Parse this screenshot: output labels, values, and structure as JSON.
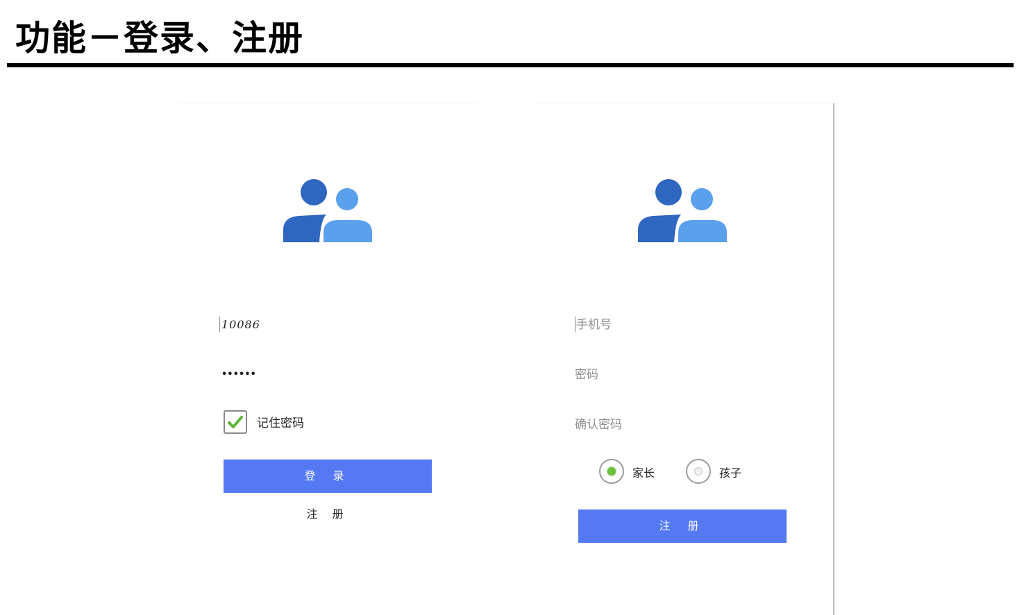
{
  "slide": {
    "title": "功能－登录、注册"
  },
  "login": {
    "avatar_icon": "users-icon",
    "username_value": "10086",
    "password_value": "••••••",
    "remember": {
      "label": "记住密码",
      "checked": true
    },
    "login_button": "登 录",
    "register_link": "注 册"
  },
  "register": {
    "avatar_icon": "users-icon",
    "phone_placeholder": "手机号",
    "password_placeholder": "密码",
    "confirm_placeholder": "确认密码",
    "roles": [
      {
        "label": "家长",
        "selected": true
      },
      {
        "label": "孩子",
        "selected": false
      }
    ],
    "register_button": "注 册"
  },
  "colors": {
    "primary": "#5479f2",
    "avatar_dark": "#2f66bf",
    "avatar_light": "#5aa0ec",
    "radio_selected": "#6cc13a"
  }
}
